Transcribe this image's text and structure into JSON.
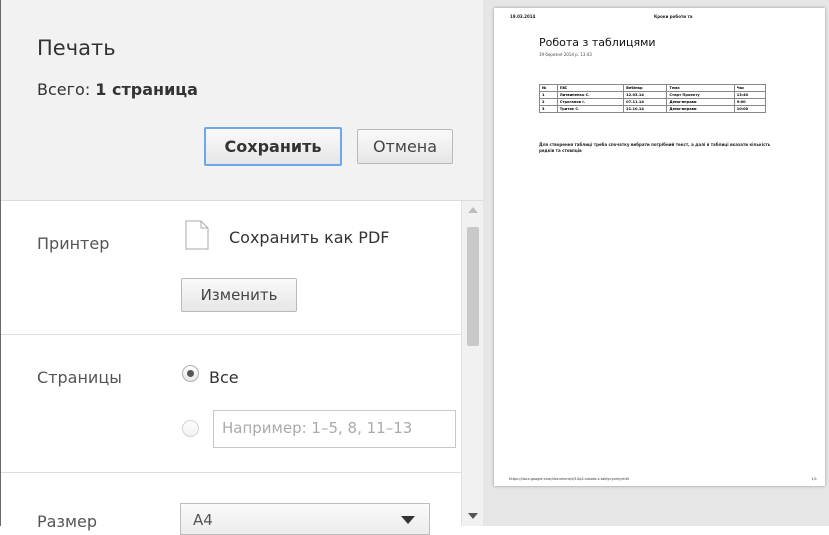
{
  "dialog": {
    "title": "Печать",
    "total_prefix": "Всего: ",
    "total_value": "1 страница",
    "save_label": "Сохранить",
    "cancel_label": "Отмена"
  },
  "printer": {
    "label": "Принтер",
    "name": "Сохранить как PDF",
    "change_label": "Изменить"
  },
  "pages": {
    "label": "Страницы",
    "all_label": "Все",
    "all_selected": true,
    "range_placeholder": "Например: 1–5, 8, 11–13"
  },
  "size": {
    "label": "Размер",
    "value": "A4"
  },
  "preview": {
    "header_left": "19.03.2014",
    "header_center": "Кроки роботи та",
    "doc_title": "Робота з таблицями",
    "doc_date": "19 березня 2014 р. 13:43",
    "table_headers": [
      "№",
      "ПІБ",
      "Вебінар",
      "Тема",
      "Час"
    ],
    "table_rows": [
      [
        "1",
        "Литвиненко С.",
        "12.03.14",
        "Старт Проекту",
        "13:40"
      ],
      [
        "2",
        "Строганов І.",
        "07.11.14",
        "Демо-вправи",
        "9:00"
      ],
      [
        "3",
        "Тритяк С.",
        "21.10.14",
        "Демо-вправи",
        "10:00"
      ]
    ],
    "note": "Для створення таблиці треба спочатку вибрати потрібний текст, а далі в таблиці вказати кількість рядків та стовпців",
    "footer": "https://docs.google.com/document/d/1Xq2-robota-z-tablycyamy/edit",
    "footer_page": "1/1"
  }
}
